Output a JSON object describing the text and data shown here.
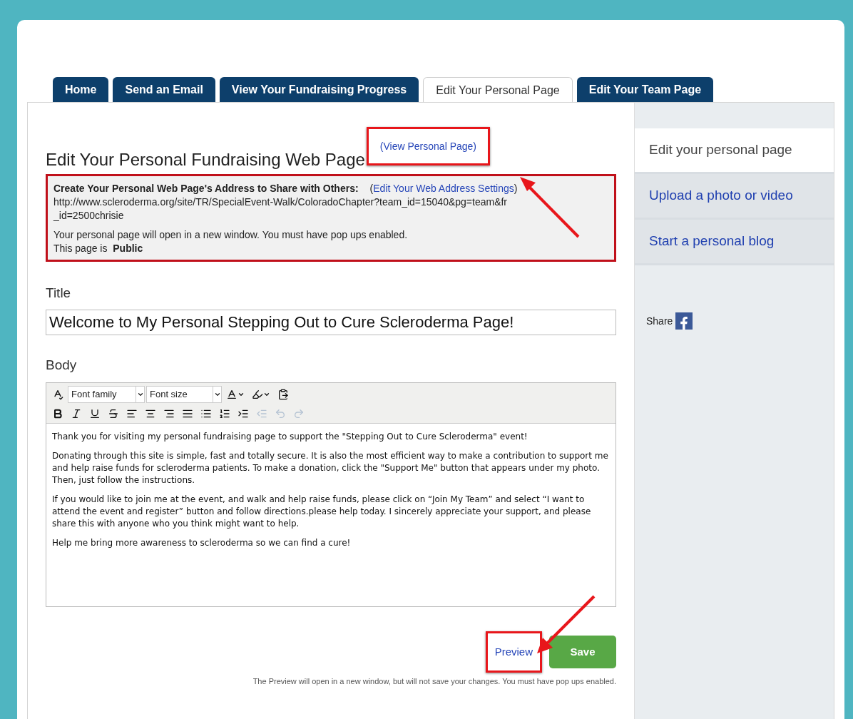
{
  "tabs": [
    {
      "label": "Home",
      "selected": false
    },
    {
      "label": "Send an Email",
      "selected": false
    },
    {
      "label": "View Your Fundraising Progress",
      "selected": false
    },
    {
      "label": "Edit Your Personal Page",
      "selected": true
    },
    {
      "label": "Edit Your Team Page",
      "selected": false
    }
  ],
  "heading": "Edit Your Personal Fundraising Web Page",
  "view_link": "(View Personal Page)",
  "address_box": {
    "label": "Create Your Personal Web Page's Address to Share with Others:",
    "link_open": "(",
    "link": "Edit Your Web Address Settings",
    "link_close": ")",
    "url": "http://www.scleroderma.org/site/TR/SpecialEvent-Walk/ColoradoChapter?team_id=15040&pg=team&fr_id=2500chrisie",
    "note": "Your personal page will open in a new window. You must have pop ups enabled.",
    "status_label": "This page is",
    "status": "Public"
  },
  "title_field": {
    "label": "Title",
    "value": "Welcome to My Personal Stepping Out to Cure Scleroderma Page!"
  },
  "body_field": {
    "label": "Body",
    "toolbar_row_1": [
      {
        "kind": "spellcheck",
        "disabled": false
      },
      {
        "kind": "font_family",
        "text": "Font family"
      },
      {
        "kind": "font_size",
        "text": "Font size"
      },
      {
        "kind": "text_color",
        "disabled": false
      },
      {
        "kind": "highlight",
        "disabled": false
      },
      {
        "kind": "paste_word",
        "disabled": false
      }
    ],
    "toolbar_row_2": [
      {
        "kind": "bold",
        "disabled": false
      },
      {
        "kind": "italic",
        "disabled": false
      },
      {
        "kind": "underline",
        "disabled": false
      },
      {
        "kind": "strikethrough",
        "disabled": false
      },
      {
        "kind": "align_left",
        "disabled": false
      },
      {
        "kind": "align_center",
        "disabled": false
      },
      {
        "kind": "align_right",
        "disabled": false
      },
      {
        "kind": "justify",
        "disabled": false
      },
      {
        "kind": "bullet_list",
        "disabled": false
      },
      {
        "kind": "numbered_list",
        "disabled": false
      },
      {
        "kind": "indent",
        "disabled": false
      },
      {
        "kind": "outdent",
        "disabled": true
      },
      {
        "kind": "undo",
        "disabled": true
      },
      {
        "kind": "redo",
        "disabled": true
      }
    ],
    "paragraphs": [
      "Thank you for visiting my personal fundraising page to support the \"Stepping Out to Cure Scleroderma\" event!",
      "Donating through this site is simple, fast and totally secure. It is also the most efficient way to make a contribution to support me and help raise funds for scleroderma patients. To make a donation, click the \"Support Me\" button that appears under my photo. Then, just follow the instructions.",
      "If you would like to join me at the event, and walk and help raise funds, please click on “Join My Team” and select “I want to attend the event and register” button and follow directions.please help today. I sincerely appreciate your support, and please share this with anyone who you think might want to help.",
      "Help me bring more awareness to scleroderma so we can find a cure!"
    ]
  },
  "preview_button": "Preview",
  "save_button": "Save",
  "preview_note": "The Preview will open in a new window, but will not save your changes. You must have pop ups enabled.",
  "sidebar": {
    "items": [
      {
        "label": "Edit your personal page",
        "selected": true
      },
      {
        "label": "Upload a photo or video",
        "selected": false
      },
      {
        "label": "Start a personal blog",
        "selected": false
      }
    ],
    "share_label": "Share"
  }
}
